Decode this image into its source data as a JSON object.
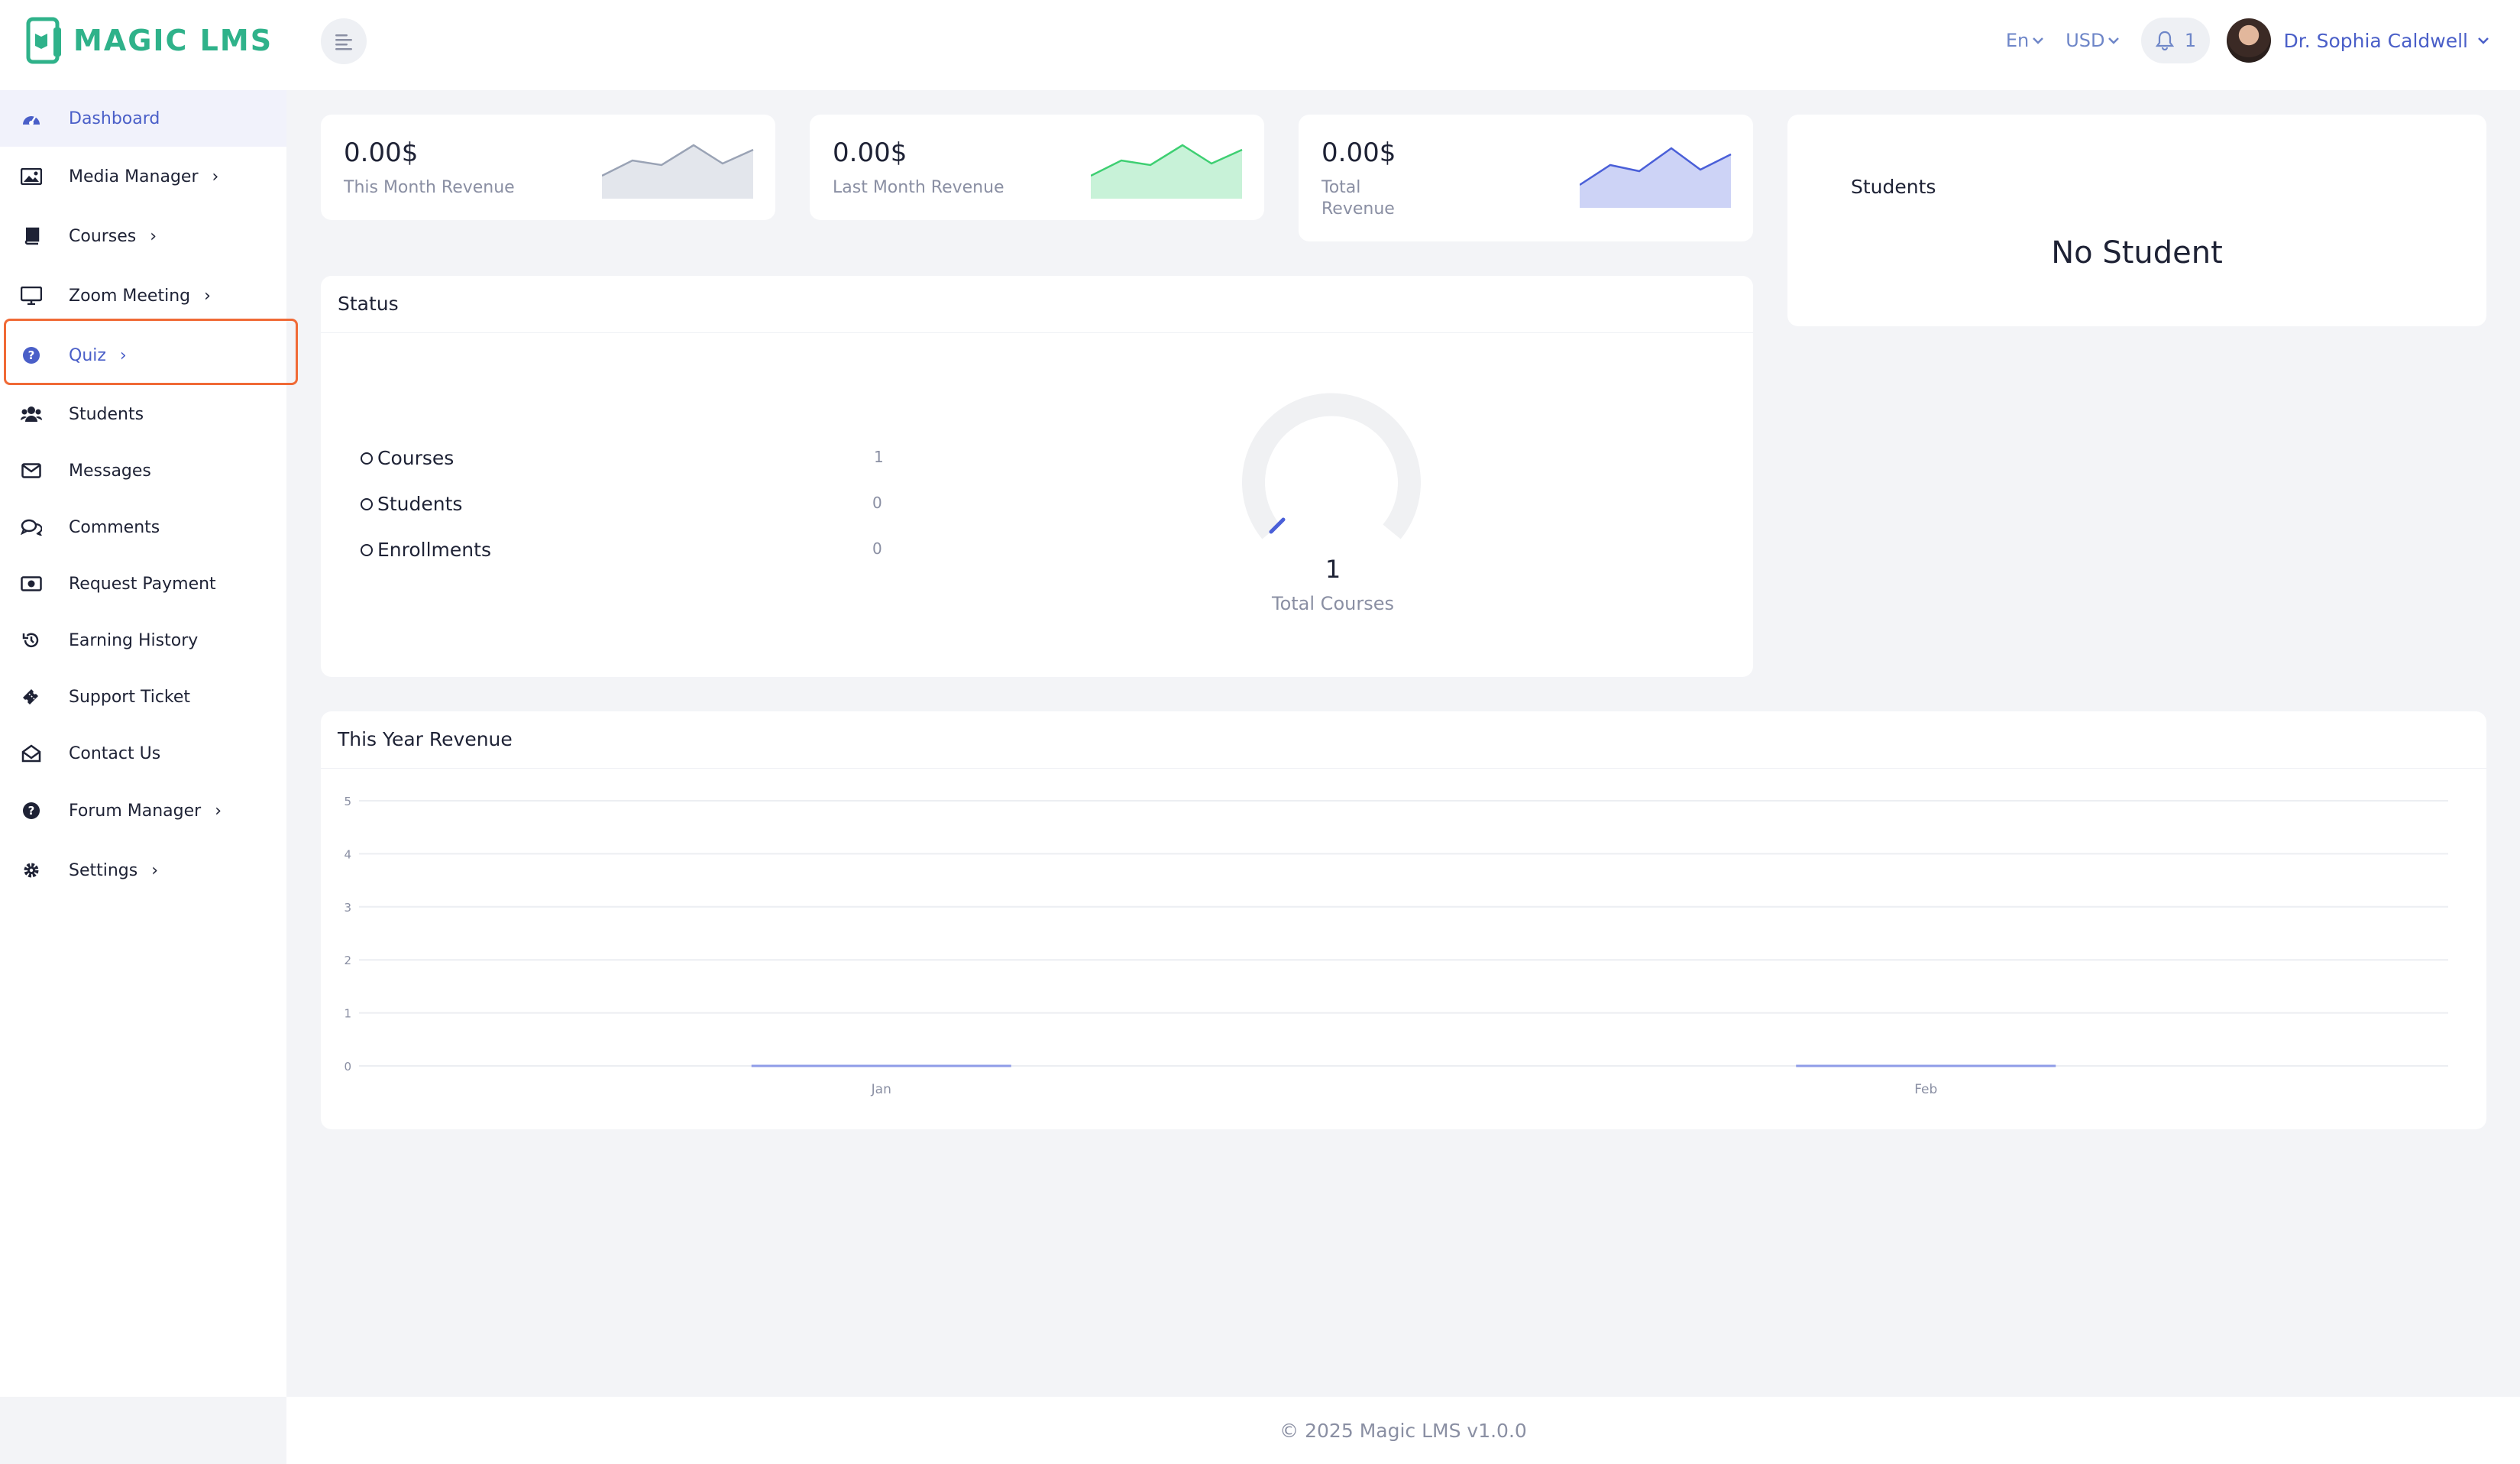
{
  "brand": {
    "name": "MAGIC LMS"
  },
  "header": {
    "language": "En",
    "currency": "USD",
    "notification_count": "1",
    "user_name": "Dr. Sophia Caldwell"
  },
  "sidebar": {
    "items": [
      {
        "label": "Dashboard",
        "icon": "dashboard-icon",
        "active": true
      },
      {
        "label": "Media Manager",
        "icon": "image-icon",
        "has_submenu": true
      },
      {
        "label": "Courses",
        "icon": "book-icon",
        "has_submenu": true
      },
      {
        "label": "Zoom Meeting",
        "icon": "monitor-icon",
        "has_submenu": true
      },
      {
        "label": "Quiz",
        "icon": "question-circle-icon",
        "has_submenu": true
      },
      {
        "label": "Students",
        "icon": "users-icon"
      },
      {
        "label": "Messages",
        "icon": "envelope-icon"
      },
      {
        "label": "Comments",
        "icon": "comments-icon"
      },
      {
        "label": "Request Payment",
        "icon": "money-icon"
      },
      {
        "label": "Earning History",
        "icon": "history-icon"
      },
      {
        "label": "Support Ticket",
        "icon": "ticket-icon"
      },
      {
        "label": "Contact Us",
        "icon": "envelope-open-icon"
      },
      {
        "label": "Forum Manager",
        "icon": "question-circle-icon",
        "has_submenu": true
      },
      {
        "label": "Settings",
        "icon": "gear-icon",
        "has_submenu": true
      }
    ]
  },
  "revenue_cards": [
    {
      "value": "0.00$",
      "label": "This Month Revenue",
      "color": "#9aa3b5"
    },
    {
      "value": "0.00$",
      "label": "Last Month Revenue",
      "color": "#3ecf72"
    },
    {
      "value": "0.00$",
      "label": "Total Revenue",
      "color": "#4a5fd8"
    }
  ],
  "students_card": {
    "title": "Students",
    "message": "No Student"
  },
  "status": {
    "title": "Status",
    "rows": [
      {
        "label": "Courses",
        "value": "1"
      },
      {
        "label": "Students",
        "value": "0"
      },
      {
        "label": "Enrollments",
        "value": "0"
      }
    ],
    "gauge_value": "1",
    "gauge_label": "Total Courses"
  },
  "chart_data": {
    "type": "line",
    "title": "This Year Revenue",
    "categories": [
      "Jan",
      "Feb"
    ],
    "series": [
      {
        "values": [
          0,
          0
        ]
      }
    ],
    "ylim": [
      0,
      5
    ],
    "yticks": [
      "0",
      "1",
      "2",
      "3",
      "4",
      "5"
    ],
    "grid": true
  },
  "footer": {
    "text": "© 2025 Magic LMS v1.0.0"
  },
  "colors": {
    "accent": "#4a5fc8",
    "brand": "#2fb28a",
    "highlight": "#f06a36"
  }
}
